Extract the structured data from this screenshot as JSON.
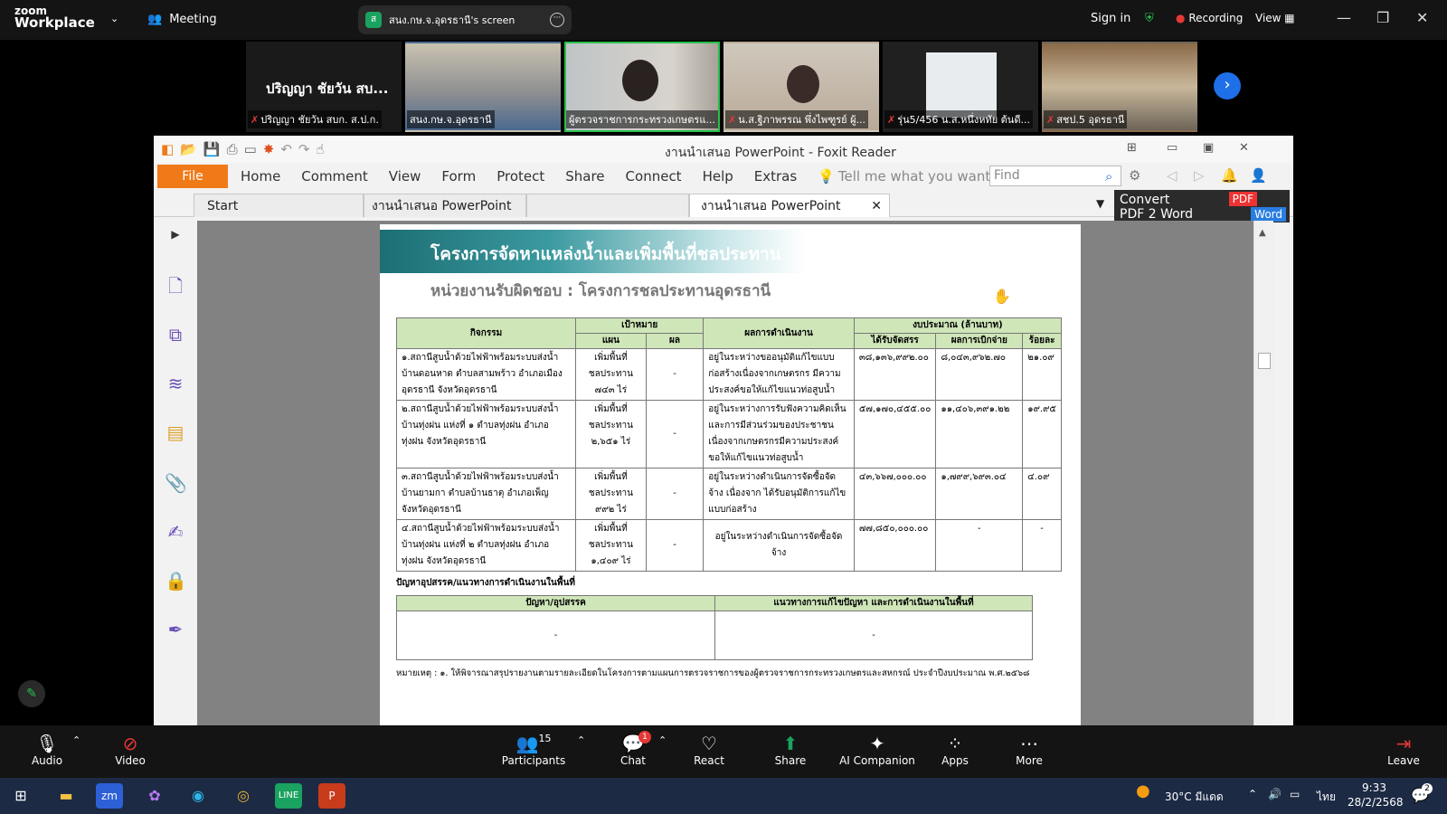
{
  "zoom": {
    "logo_top": "zoom",
    "logo_bottom": "Workplace",
    "meeting_label": "Meeting",
    "screen_share_label": "สนง.กษ.จ.อุดรธานี's screen",
    "share_badge_letter": "ส",
    "sign_in": "Sign in",
    "recording": "Recording",
    "view": "View",
    "accent_color": "#27c04b"
  },
  "participants": [
    {
      "name": "ปริญญา ชัยวัน สบ...",
      "caption": "ปริญญา ชัยวัน สบก. ส.ป.ก."
    },
    {
      "caption": "สนง.กษ.จ.อุดรธานี"
    },
    {
      "caption": "ผู้ตรวจราชการกระทรวงเกษตรแ..."
    },
    {
      "caption": "น.ส.ฐิภาพรรณ พึ่งไพฑูรย์ ผู้..."
    },
    {
      "caption": "รุ่น5/456 น.ส.หนึ่งหทัย ต้นดี..."
    },
    {
      "caption": "สชป.5 อุดรธานี"
    }
  ],
  "foxit": {
    "title": "งานนำเสนอ PowerPoint - Foxit Reader",
    "menu": [
      "Home",
      "Comment",
      "View",
      "Form",
      "Protect",
      "Share",
      "Connect",
      "Help",
      "Extras"
    ],
    "file_label": "File",
    "tell_me": "Tell me what you want to",
    "find_placeholder": "Find",
    "tabs": [
      "Start",
      "งานนำเสนอ PowerPoint",
      "งานนำเสนอ PowerPoint"
    ],
    "convert_line1": "Convert",
    "convert_line2": "PDF 2 Word",
    "convert_pdf": "PDF",
    "convert_word": "Word"
  },
  "slide": {
    "title": "โครงการจัดหาแหล่งน้ำและเพิ่มพื้นที่ชลประทาน",
    "subtitle": "หน่วยงานรับผิดชอบ : โครงการชลประทานอุดรธานี",
    "headers": {
      "activity": "กิจกรรม",
      "target": "เป้าหมาย",
      "plan": "แผน",
      "result": "ผล",
      "performance": "ผลการดำเนินงาน",
      "budget": "งบประมาณ (ล้านบาท)",
      "allocated": "ได้รับจัดสรร",
      "disbursed": "ผลการเบิกจ่าย",
      "percent": "ร้อยละ"
    },
    "rows": [
      {
        "activity": "๑.สถานีสูบน้ำด้วยไฟฟ้าพร้อมระบบส่งน้ำบ้านดอนหาด ตำบลสามพร้าว อำเภอเมืองอุดรธานี จังหวัดอุดรธานี",
        "plan": "เพิ่มพื้นที่ชลประทาน ๗๔๓ ไร่",
        "result": "-",
        "performance": "อยู่ในระหว่างขออนุมัติแก้ไขแบบก่อสร้างเนื่องจากเกษตรกร มีความประสงค์ขอให้แก้ไขแนวท่อสูบน้ำ",
        "allocated": "๓๘,๑๓๖,๙๙๒.๐๐",
        "disbursed": "๘,๐๔๓,๙๖๒.๗๐",
        "percent": "๒๑.๐๙"
      },
      {
        "activity": "๒.สถานีสูบน้ำด้วยไฟฟ้าพร้อมระบบส่งน้ำบ้านทุ่งฝน แห่งที่ ๑ ตำบลทุ่งฝน อำเภอทุ่งฝน จังหวัดอุดรธานี",
        "plan": "เพิ่มพื้นที่ชลประทาน ๒,๖๕๑ ไร่",
        "result": "-",
        "performance": "อยู่ในระหว่างการรับฟังความคิดเห็นและการมีส่วนร่วมของประชาชน เนื่องจากเกษตรกรมีความประสงค์ขอให้แก้ไขแนวท่อสูบน้ำ",
        "allocated": "๕๗,๑๗๐,๔๕๕.๐๐",
        "disbursed": "๑๑,๔๐๖,๓๙๑.๒๒",
        "percent": "๑๙.๙๕"
      },
      {
        "activity": "๓.สถานีสูบน้ำด้วยไฟฟ้าพร้อมระบบส่งน้ำบ้านยามกา ตำบลบ้านธาตุ อำเภอเพ็ญ จังหวัดอุดรธานี",
        "plan": "เพิ่มพื้นที่ชลประทาน ๙๙๒ ไร่",
        "result": "-",
        "performance": "อยู่ในระหว่างดำเนินการจัดซื้อจัดจ้าง เนื่องจาก ได้รับอนุมัติการแก้ไขแบบก่อสร้าง",
        "allocated": "๔๓,๖๖๗,๐๐๐.๐๐",
        "disbursed": "๑,๗๙๙,๖๙๓.๐๔",
        "percent": "๔.๐๙"
      },
      {
        "activity": "๔.สถานีสูบน้ำด้วยไฟฟ้าพร้อมระบบส่งน้ำบ้านทุ่งฝน แห่งที่ ๒ ตำบลทุ่งฝน อำเภอทุ่งฝน จังหวัดอุดรธานี",
        "plan": "เพิ่มพื้นที่ชลประทาน ๑,๔๐๙ ไร่",
        "result": "-",
        "performance": "อยู่ในระหว่างดำเนินการจัดซื้อจัดจ้าง",
        "allocated": "๗๗,๘๕๐,๐๐๐.๐๐",
        "disbursed": "-",
        "percent": "-"
      }
    ],
    "problems_heading": "ปัญหาอุปสรรค/แนวทางการดำเนินงานในพื้นที่",
    "problem_col": "ปัญหา/อุปสรรค",
    "solution_col": "แนวทางการแก้ไขปัญหา และการดำเนินงานในพื้นที่",
    "problem_value": "-",
    "solution_value": "-",
    "note": "หมายเหตุ : ๑. ให้พิจารณาสรุปรายงานตามรายละเอียดในโครงการตามแผนการตรวจราชการของผู้ตรวจราชการกระทรวงเกษตรและสหกรณ์ ประจำปีงบประมาณ พ.ศ.๒๕๖๘"
  },
  "toolbar": {
    "audio": "Audio",
    "video": "Video",
    "participants": "Participants",
    "participants_count": "15",
    "chat": "Chat",
    "chat_badge": "1",
    "react": "React",
    "share": "Share",
    "ai": "AI Companion",
    "apps": "Apps",
    "more": "More",
    "leave": "Leave"
  },
  "taskbar": {
    "weather": "30°C มีแดด",
    "lang": "ไทย",
    "time": "9:33",
    "date": "28/2/2568",
    "notif_count": "2"
  }
}
